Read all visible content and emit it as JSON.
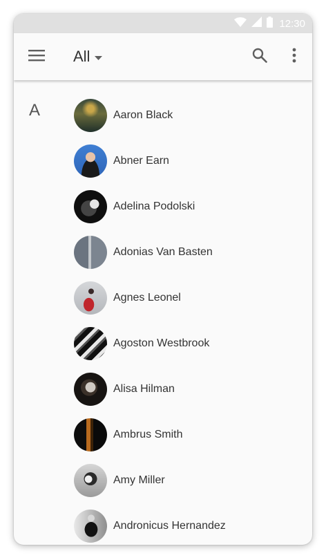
{
  "status_bar": {
    "time": "12:30",
    "icons": [
      "wifi-icon",
      "cell-signal-icon",
      "battery-icon"
    ]
  },
  "app_bar": {
    "menu_icon": "menu-icon",
    "filter_label": "All",
    "dropdown_icon": "dropdown-arrow-icon",
    "search_icon": "search-icon",
    "more_icon": "more-vert-icon"
  },
  "contacts": {
    "section_letter": "A",
    "items": [
      {
        "name": "Aaron Black"
      },
      {
        "name": "Abner Earn"
      },
      {
        "name": "Adelina Podolski"
      },
      {
        "name": "Adonias Van Basten"
      },
      {
        "name": "Agnes Leonel"
      },
      {
        "name": "Agoston Westbrook"
      },
      {
        "name": "Alisa Hilman"
      },
      {
        "name": "Ambrus Smith"
      },
      {
        "name": "Amy Miller"
      },
      {
        "name": "Andronicus Hernandez"
      }
    ]
  },
  "colors": {
    "status_bar": "#e0e0e0",
    "app_bar": "#fafafa",
    "background": "#fafafa",
    "text_primary": "#333333",
    "icon": "#5f5f5f"
  }
}
